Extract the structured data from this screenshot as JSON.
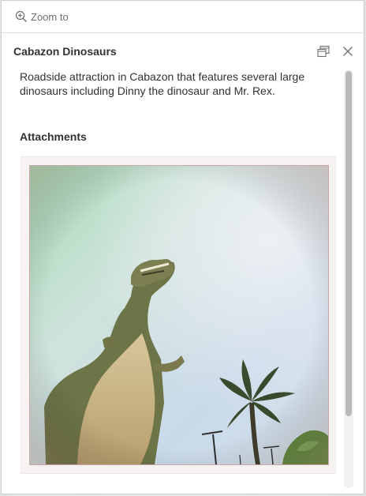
{
  "toolbar": {
    "zoom_label": "Zoom to"
  },
  "popup": {
    "title": "Cabazon Dinosaurs",
    "description": "Roadside attraction in Cabazon that features several large dinosaurs including Dinny the dinosaur and Mr. Rex.",
    "attachments_heading": "Attachments",
    "attachment_caption": "",
    "icons": {
      "zoom": "zoom-in-icon",
      "dock": "dock-icon",
      "close": "close-icon"
    }
  },
  "colors": {
    "text": "#323232",
    "muted": "#6e6e6e",
    "scroll_thumb": "#b9b9b9"
  }
}
